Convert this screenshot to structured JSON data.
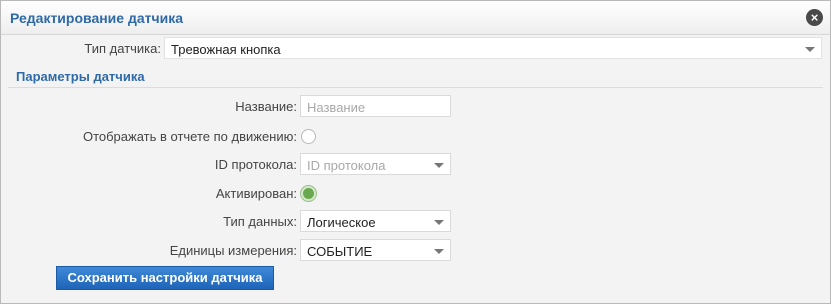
{
  "dialog": {
    "title": "Редактирование датчика",
    "close_icon": "×"
  },
  "sensor_type": {
    "label": "Тип датчика:",
    "value": "Тревожная кнопка"
  },
  "params_section": {
    "title": "Параметры датчика"
  },
  "fields": {
    "name_label": "Название:",
    "name_placeholder": "Название",
    "show_in_report_label": "Отображать в отчете по движению:",
    "show_in_report_checked": false,
    "protocol_id_label": "ID протокола:",
    "protocol_id_placeholder": "ID протокола",
    "activated_label": "Активирован:",
    "activated_checked": true,
    "data_type_label": "Тип данных:",
    "data_type_value": "Логическое",
    "units_label": "Единицы измерения:",
    "units_value": "СОБЫТИЕ"
  },
  "actions": {
    "save_label": "Сохранить настройки датчика"
  },
  "colors": {
    "accent": "#2e6aa8",
    "button": "#1e63b8",
    "active_radio": "#6aa84f"
  }
}
